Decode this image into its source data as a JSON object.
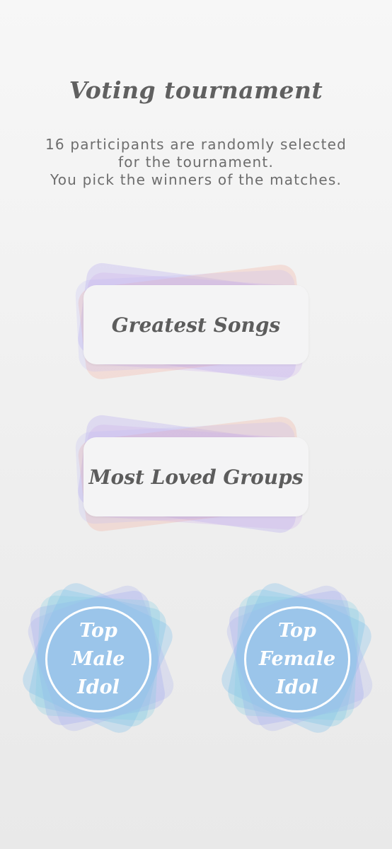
{
  "header": {
    "title": "Voting tournament",
    "subtitle_lines": [
      "16 participants are randomly selected",
      "for the tournament.",
      "You pick the winners of the matches."
    ]
  },
  "categories": [
    {
      "label": "Greatest Songs"
    },
    {
      "label": "Most Loved Groups"
    }
  ],
  "idols": [
    {
      "lines": [
        "Top",
        "Male",
        "Idol"
      ]
    },
    {
      "lines": [
        "Top",
        "Female",
        "Idol"
      ]
    }
  ]
}
